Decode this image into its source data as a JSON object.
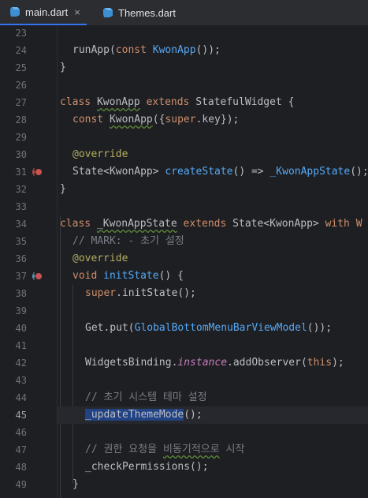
{
  "tabs": [
    {
      "label": "main.dart",
      "active": true,
      "close": "×"
    },
    {
      "label": "Themes.dart",
      "active": false
    }
  ],
  "line_numbers": [
    "23",
    "24",
    "25",
    "26",
    "27",
    "28",
    "29",
    "30",
    "31",
    "32",
    "33",
    "34",
    "35",
    "36",
    "37",
    "38",
    "39",
    "40",
    "41",
    "42",
    "43",
    "44",
    "45",
    "46",
    "47",
    "48",
    "49"
  ],
  "current_line": "45",
  "code": {
    "l24_a": "runApp(",
    "l24_b": "const ",
    "l24_c": "KwonApp",
    "l24_d": "());",
    "l25": "}",
    "l27_a": "class ",
    "l27_b": "KwonApp",
    "l27_c": " extends ",
    "l27_d": "StatefulWidget {",
    "l28_a": "const ",
    "l28_b": "KwonApp",
    "l28_c": "({",
    "l28_d": "super",
    "l28_e": ".key});",
    "l30": "@override",
    "l31_a": "State<KwonApp> ",
    "l31_b": "createState",
    "l31_c": "() => ",
    "l31_d": "_KwonAppState",
    "l31_e": "();",
    "l32": "}",
    "l34_a": "class ",
    "l34_b": "_KwonAppState",
    "l34_c": " extends ",
    "l34_d": "State<KwonApp> ",
    "l34_e": "with W",
    "l35": "// MARK: - 초기 설정",
    "l36": "@override",
    "l37_a": "void ",
    "l37_b": "initState",
    "l37_c": "() {",
    "l38_a": "super",
    "l38_b": ".initState();",
    "l40_a": "Get.put(",
    "l40_b": "GlobalBottomMenuBarViewModel",
    "l40_c": "());",
    "l42_a": "WidgetsBinding.",
    "l42_b": "instance",
    "l42_c": ".addObserver(",
    "l42_d": "this",
    "l42_e": ");",
    "l44": "// 초기 시스템 테마 설정",
    "l45_a": "_updateThemeMode",
    "l45_b": "();",
    "l47_a": "// 권한 요청을 ",
    "l47_b": "비동기적으로",
    "l47_c": " 시작",
    "l48": "_checkPermissions();",
    "l49": "}"
  },
  "colors": {
    "background": "#1e1f22",
    "keyword": "#cf8e6d",
    "function": "#56a8f5",
    "annotation": "#b3ae60",
    "comment": "#7a7e85",
    "selection": "#214283",
    "tab_accent": "#3574f0"
  },
  "icons": {
    "tab_file": "dart-file-icon",
    "gutter_31": "override-implements-icon",
    "gutter_37": "override-implements-icon"
  }
}
